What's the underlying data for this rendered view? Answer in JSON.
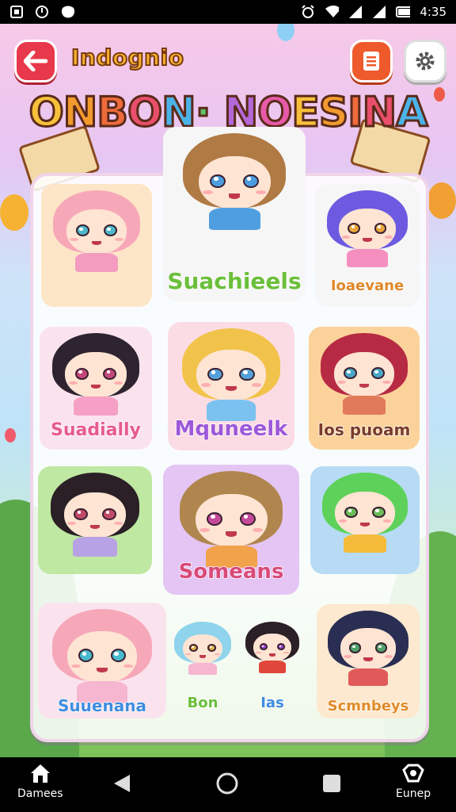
{
  "status_bar": {
    "time": "4:35",
    "left_icons": [
      "notification-icon",
      "clock-icon",
      "game-icon"
    ],
    "right_icons": [
      "alarm-icon",
      "wifi-icon",
      "signal-icon",
      "signal-icon",
      "battery-icon"
    ]
  },
  "header": {
    "title": "Indognio",
    "banner": "ONBON· NOESINA",
    "banner_colors": [
      "#f7c03a",
      "#f29a2e",
      "#ef6b3b",
      "#e94e6b",
      "#4bb3e8",
      "#5dc36a",
      "#b367d8",
      "#e85aa8"
    ]
  },
  "cards": [
    {
      "label": "",
      "bg": "#fde6c7"
    },
    {
      "label": "Suachieels",
      "bg": "#f6f6f6",
      "color": "#6bbf3a"
    },
    {
      "label": "Ioaevane",
      "bg": "#f6f6f6",
      "color": "#e0882a"
    },
    {
      "label": "Suadially",
      "bg": "#fbe3ee",
      "color": "#e65a8e"
    },
    {
      "label": "Mquneelk",
      "bg": "#fcdce4",
      "color": "#9c58d9"
    },
    {
      "label": "Ios puoam",
      "bg": "#fbd29a",
      "color": "#7a3b2a"
    },
    {
      "label": "",
      "bg": "#bfe8a3"
    },
    {
      "label": "Someans",
      "bg": "#e4c5f4",
      "color": "#d94a78"
    },
    {
      "label": "",
      "bg": "#b7dbf5"
    },
    {
      "label": "Suuenana",
      "bg": "#fbe3ee",
      "color": "#3e8de0"
    },
    {
      "label": "Bon",
      "bg": "transparent",
      "color": "#6bbf3a"
    },
    {
      "label": "Ias",
      "bg": "transparent",
      "color": "#3e8de0"
    },
    {
      "label": "Scmnbeys",
      "bg": "#fde9d0",
      "color": "#e08b28"
    }
  ],
  "nav": {
    "home_label": "Damees",
    "right_label": "Eunep"
  }
}
